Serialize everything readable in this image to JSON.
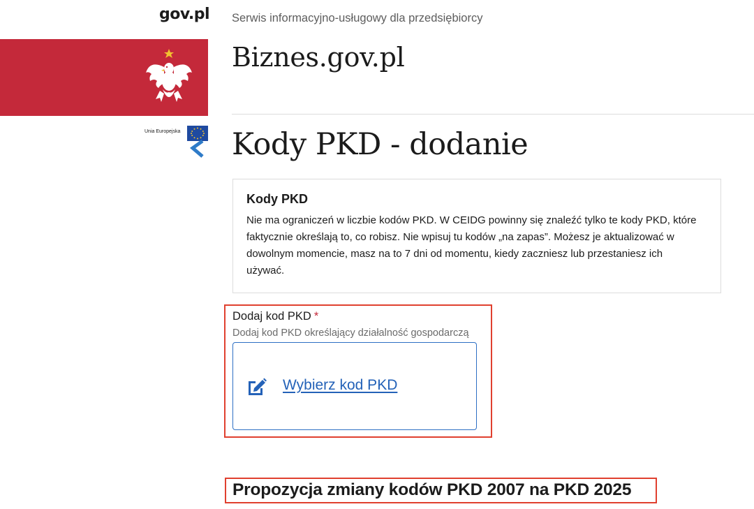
{
  "header": {
    "gov_link": "gov.pl",
    "tagline": "Serwis informacyjno-usługowy dla przedsiębiorcy",
    "site_name": "Biznes.gov.pl",
    "eu_label": "Unia Europejska"
  },
  "page": {
    "title": "Kody PKD - dodanie"
  },
  "info_box": {
    "title": "Kody PKD",
    "lines": [
      "Nie ma ograniczeń w liczbie kodów PKD. W CEIDG powinny się znaleźć tylko te kody PKD, które",
      "faktycznie określają to, co robisz. Nie wpisuj tu kodów „na zapas”. Możesz je aktualizować w",
      "dowolnym momencie, masz na to 7 dni od momentu, kiedy zaczniesz lub przestaniesz ich",
      "używać."
    ]
  },
  "form": {
    "label": "Dodaj kod PKD",
    "required_mark": "*",
    "hint": "Dodaj kod PKD określający działalność gospodarczą",
    "picker_link": "Wybierz kod PKD",
    "picker_icon": "edit-icon"
  },
  "section": {
    "heading": "Propozycja zmiany kodów PKD 2007 na PKD 2025"
  },
  "colors": {
    "brand_red": "#c4293a",
    "link_blue": "#2462b8",
    "highlight": "#e0402f"
  }
}
